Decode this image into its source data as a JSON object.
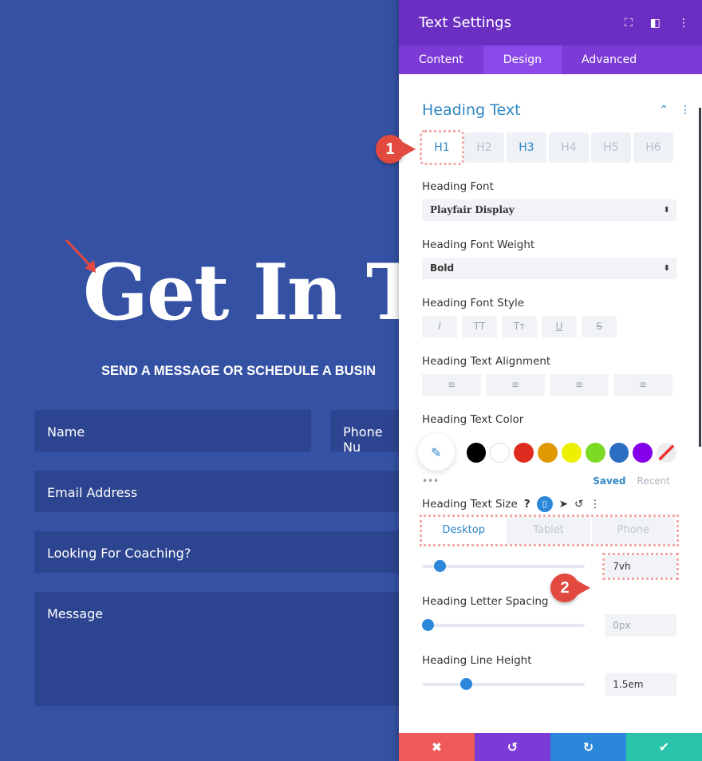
{
  "page": {
    "headline": "Get In To",
    "subtitle": "SEND A MESSAGE OR SCHEDULE A BUSIN",
    "fields": {
      "name": "Name",
      "phone": "Phone Nu",
      "email": "Email Address",
      "coaching": "Looking For Coaching?",
      "message": "Message"
    }
  },
  "panel": {
    "title": "Text Settings",
    "tabs": [
      "Content",
      "Design",
      "Advanced"
    ],
    "section": "Heading Text",
    "heading_tabs": [
      "H1",
      "H2",
      "H3",
      "H4",
      "H5",
      "H6"
    ],
    "font_label": "Heading Font",
    "font_value": "Playfair Display",
    "weight_label": "Heading Font Weight",
    "weight_value": "Bold",
    "style_label": "Heading Font Style",
    "style_buttons": [
      "I",
      "TT",
      "Tт",
      "U",
      "S"
    ],
    "align_label": "Heading Text Alignment",
    "color_label": "Heading Text Color",
    "swatches": [
      "#000000",
      "#ffffff",
      "#e02b20",
      "#e09900",
      "#edf000",
      "#7cda24",
      "#2b6fc2",
      "#8300e9"
    ],
    "saved": "Saved",
    "recent": "Recent",
    "more": "•••",
    "size_label": "Heading Text Size",
    "help": "?",
    "devices": [
      "Desktop",
      "Tablet",
      "Phone"
    ],
    "size_value": "7vh",
    "size_fraction": 0.08,
    "spacing_label": "Heading Letter Spacing",
    "spacing_value": "0px",
    "spacing_fraction": 0,
    "lineheight_label": "Heading Line Height",
    "lineheight_value": "1.5em",
    "lineheight_fraction": 0.25,
    "footer": {
      "cancel": "✖",
      "undo": "↺",
      "redo": "↻",
      "save": "✔"
    }
  },
  "badges": [
    "1",
    "2"
  ]
}
